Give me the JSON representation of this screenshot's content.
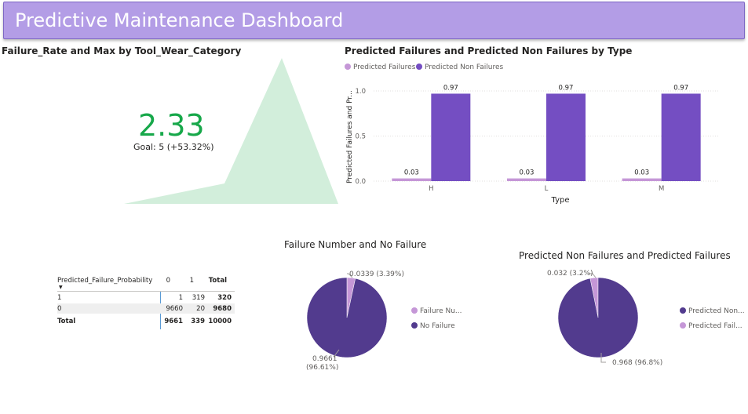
{
  "header": {
    "title": "Predictive Maintenance Dashboard"
  },
  "kpi": {
    "title": "Failure_Rate and Max by Tool_Wear_Category",
    "value": "2.33",
    "status_icon": "check-icon",
    "goal": "Goal: 5 (+53.32%)",
    "area_color": "#d2eedb",
    "value_color": "#17a84a"
  },
  "bar_chart": {
    "title": "Predicted Failures and Predicted Non Failures by Type",
    "legend": [
      {
        "label": "Predicted Failures",
        "color": "#c597d7"
      },
      {
        "label": "Predicted Non Failures",
        "color": "#744ec2"
      }
    ],
    "ylabel": "Predicted Failures and Pr...",
    "xlabel": "Type"
  },
  "matrix": {
    "header": {
      "label": "Predicted_Failure_Probability",
      "c0": "0",
      "c1": "1",
      "total": "Total"
    },
    "rows": [
      {
        "label": "1",
        "c0": "1",
        "c1": "319",
        "total": "320"
      },
      {
        "label": "0",
        "c0": "9660",
        "c1": "20",
        "total": "9680"
      }
    ],
    "total_row": {
      "label": "Total",
      "c0": "9661",
      "c1": "339",
      "total": "10000"
    }
  },
  "pie1": {
    "title": "Failure Number and No Failure",
    "legend": [
      {
        "label": "Failure Nu...",
        "color": "#c597d7"
      },
      {
        "label": "No Failure",
        "color": "#523b8e"
      }
    ],
    "small_label": "0.0339 (3.39%)",
    "large_label_line1": "0.9661",
    "large_label_line2": "(96.61%)"
  },
  "pie2": {
    "title": "Predicted Non Failures and Predicted Failures",
    "legend": [
      {
        "label": "Predicted Non...",
        "color": "#523b8e"
      },
      {
        "label": "Predicted Fail...",
        "color": "#c597d7"
      }
    ],
    "small_label": "0.032 (3.2%)",
    "large_label": "0.968 (96.8%)"
  },
  "chart_data": [
    {
      "type": "area",
      "title": "Failure_Rate and Max by Tool_Wear_Category",
      "kpi_value": 2.33,
      "goal": 5,
      "goal_delta": "+53.32%"
    },
    {
      "type": "bar",
      "title": "Predicted Failures and Predicted Non Failures by Type",
      "categories": [
        "H",
        "L",
        "M"
      ],
      "series": [
        {
          "name": "Predicted Failures",
          "values": [
            0.03,
            0.03,
            0.03
          ],
          "color": "#c597d7"
        },
        {
          "name": "Predicted Non Failures",
          "values": [
            0.97,
            0.97,
            0.97
          ],
          "color": "#744ec2"
        }
      ],
      "xlabel": "Type",
      "ylabel": "Predicted Failures and Pr...",
      "ylim": [
        0,
        1.0
      ],
      "yticks": [
        "0.0",
        "0.5",
        "1.0"
      ],
      "data_labels": true,
      "legend": "top-left"
    },
    {
      "type": "pie",
      "title": "Failure Number and No Failure",
      "labels": [
        "Failure Nu...",
        "No Failure"
      ],
      "values": [
        0.0339,
        0.9661
      ],
      "colors": [
        "#c597d7",
        "#523b8e"
      ],
      "legend": "right"
    },
    {
      "type": "pie",
      "title": "Predicted Non Failures and Predicted Failures",
      "labels": [
        "Predicted Non...",
        "Predicted Fail..."
      ],
      "values": [
        0.968,
        0.032
      ],
      "colors": [
        "#523b8e",
        "#c597d7"
      ],
      "legend": "right"
    }
  ]
}
